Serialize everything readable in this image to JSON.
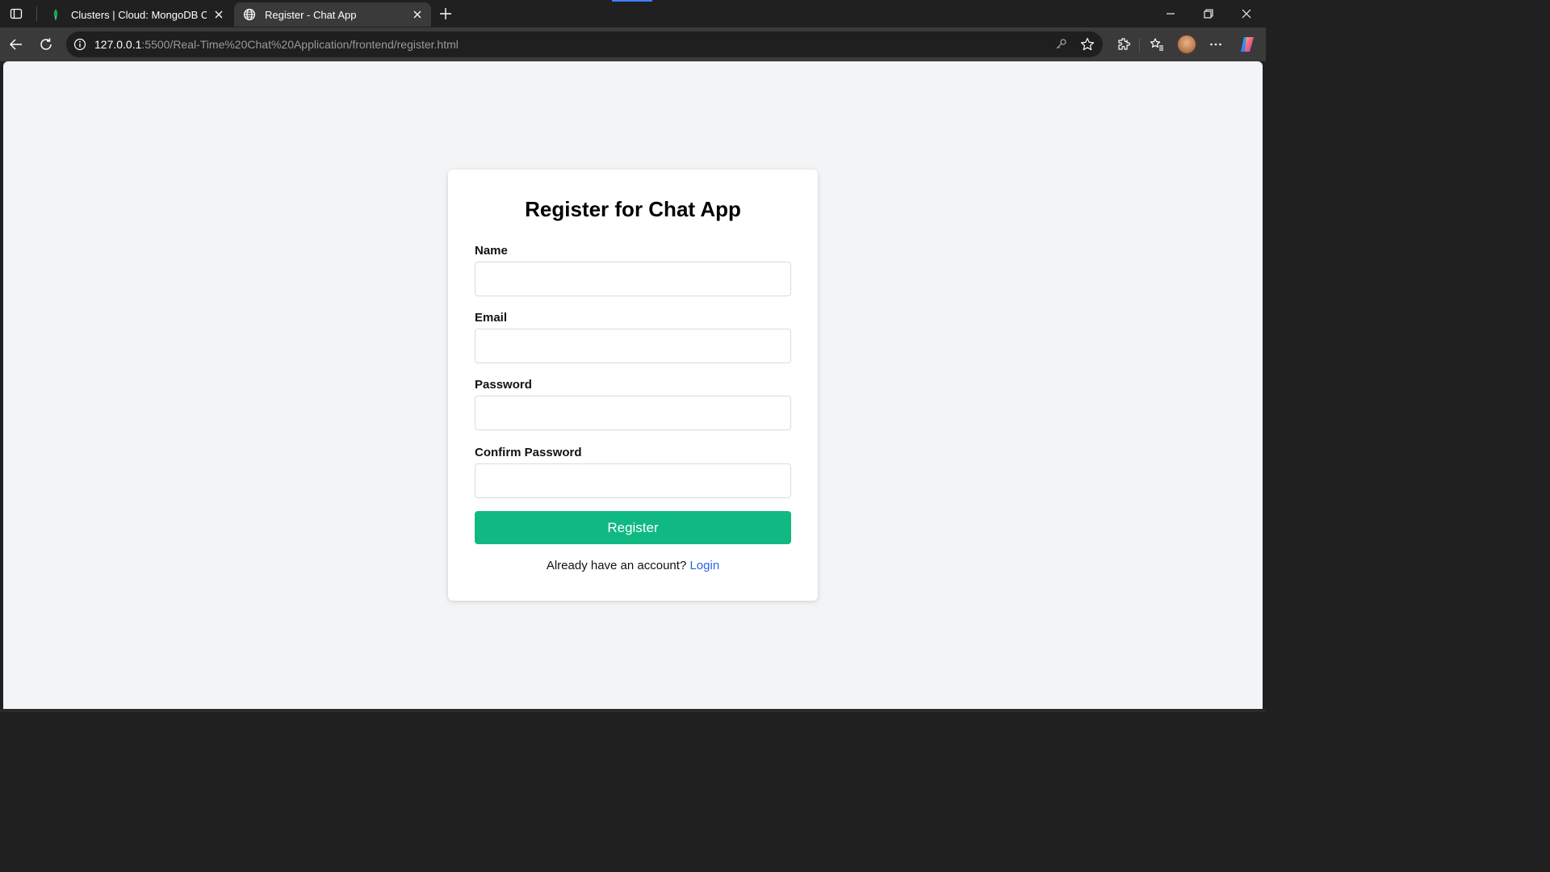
{
  "browser": {
    "tabs": [
      {
        "title": "Clusters | Cloud: MongoDB Cloud",
        "favicon": "mongodb-leaf-icon",
        "active": false
      },
      {
        "title": "Register - Chat App",
        "favicon": "globe-icon",
        "active": true
      }
    ],
    "url_host": "127.0.0.1",
    "url_rest": ":5500/Real-Time%20Chat%20Application/frontend/register.html"
  },
  "form": {
    "title": "Register for Chat App",
    "fields": [
      {
        "label": "Name",
        "value": ""
      },
      {
        "label": "Email",
        "value": ""
      },
      {
        "label": "Password",
        "value": ""
      },
      {
        "label": "Confirm Password",
        "value": ""
      }
    ],
    "submit_label": "Register",
    "footer_text": "Already have an account?",
    "login_link": "Login"
  },
  "colors": {
    "accent_green": "#10b981",
    "link_blue": "#2563eb",
    "page_background": "#f3f4f6"
  }
}
